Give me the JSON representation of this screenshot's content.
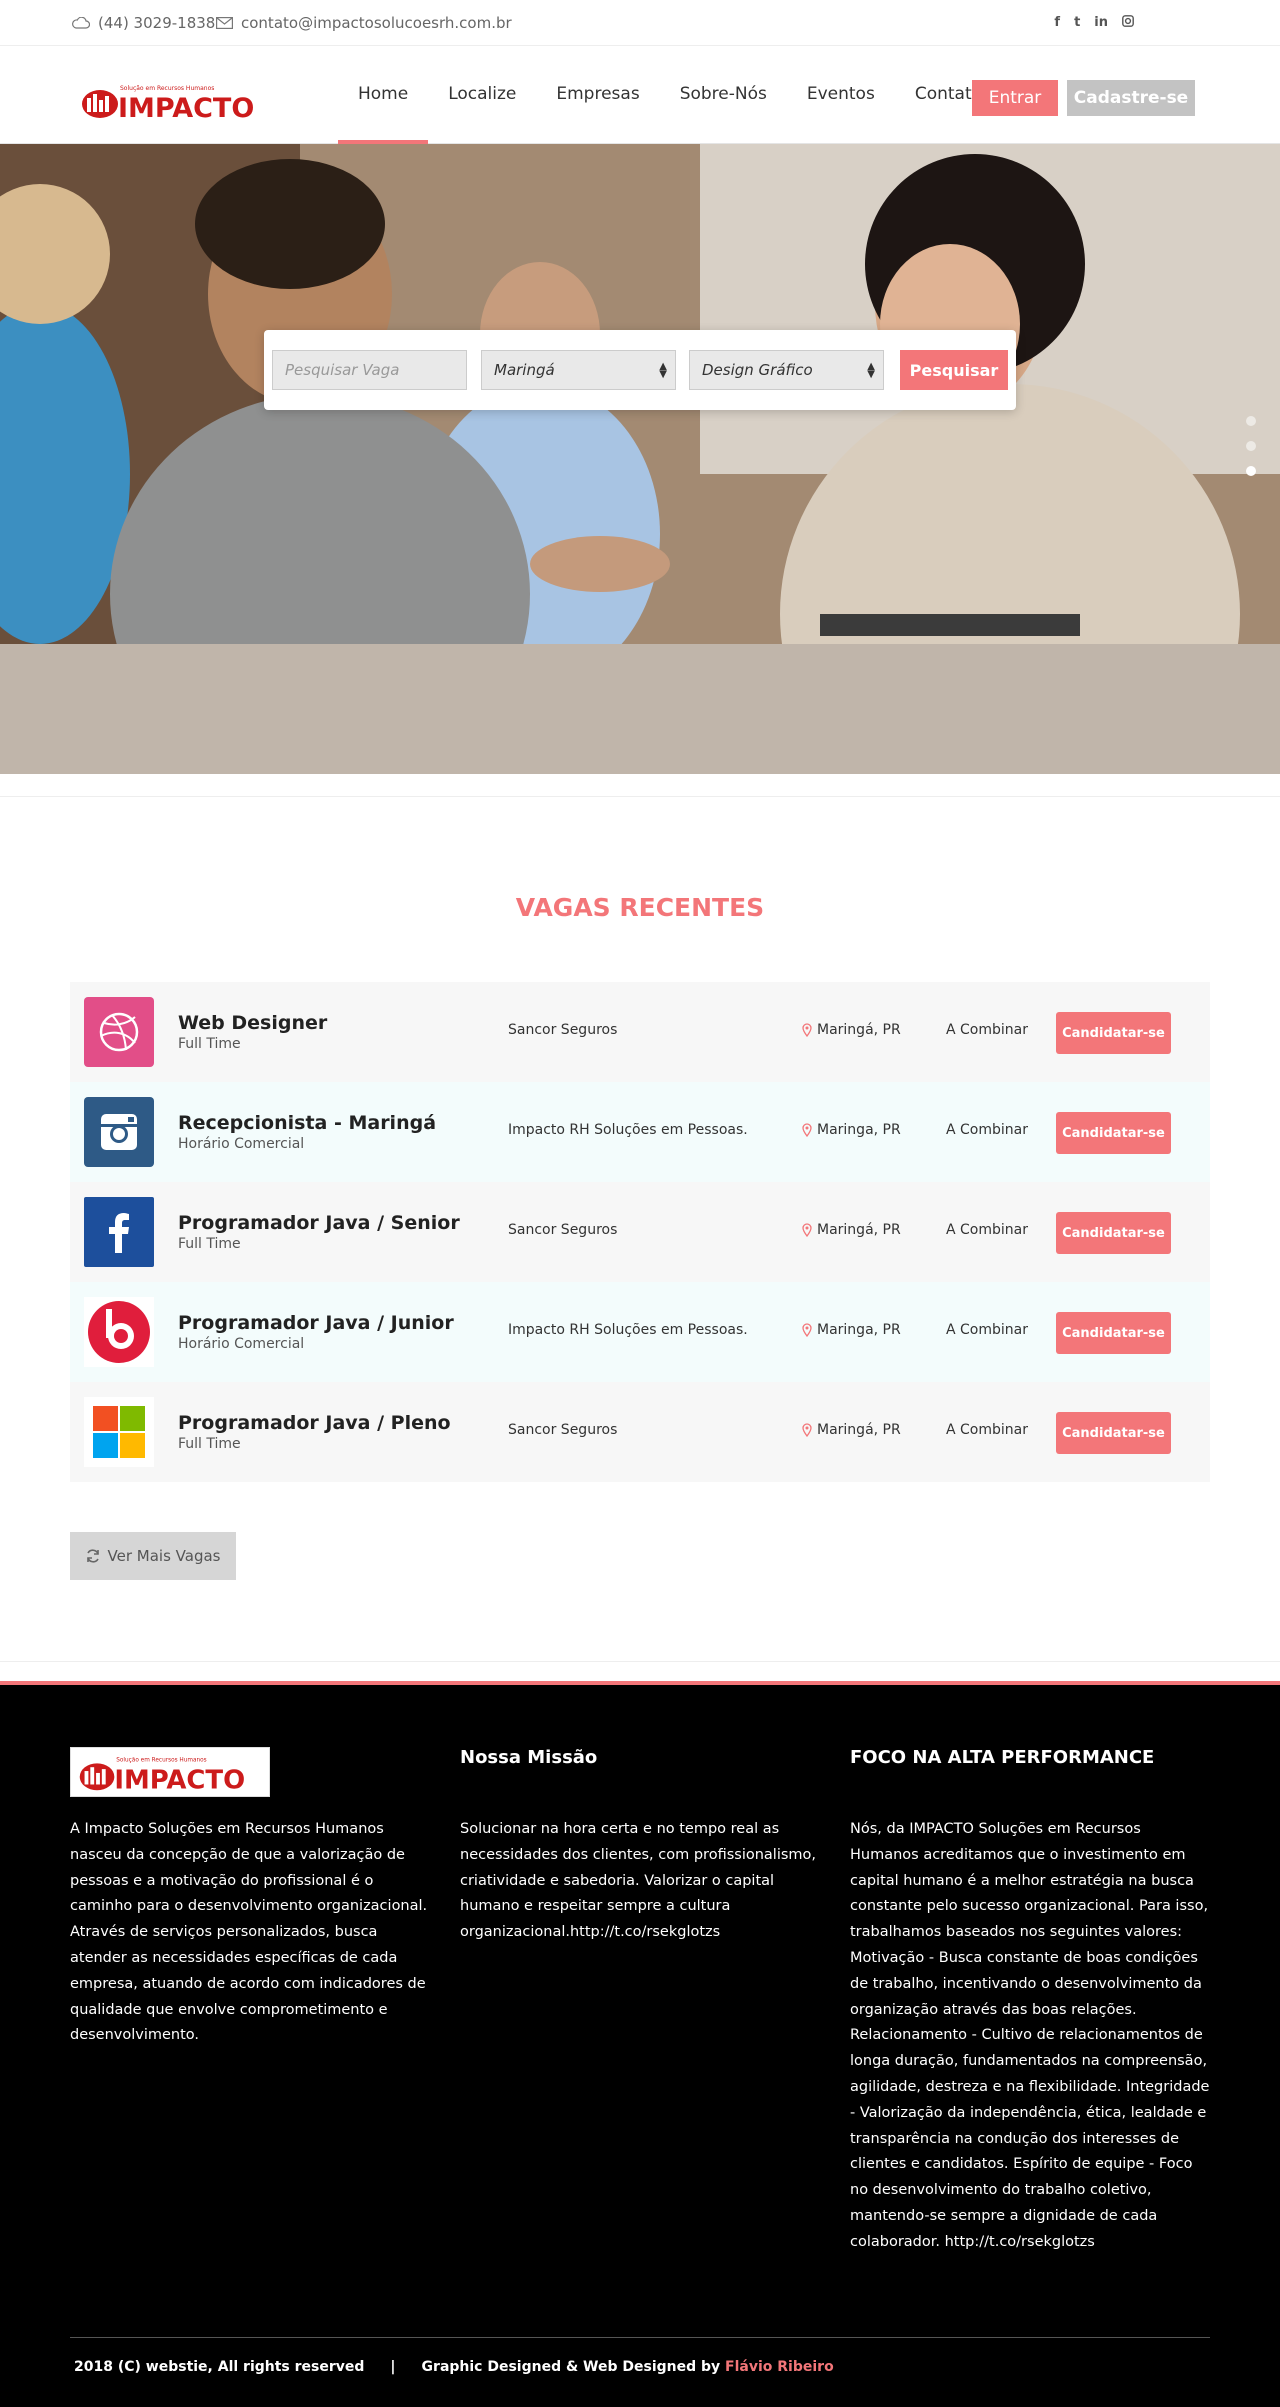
{
  "topbar": {
    "phone": "(44) 3029-1838",
    "email": "contato@impactosolucoesrh.com.br",
    "social": [
      "f",
      "t",
      "in",
      "ig"
    ]
  },
  "brand": {
    "name": "IMPACTO",
    "tagline": "Solução em Recursos Humanos",
    "accent": "#f37679",
    "logo_red": "#cc1b1b"
  },
  "nav": {
    "items": [
      "Home",
      "Localize",
      "Empresas",
      "Sobre-Nós",
      "Eventos",
      "Contato"
    ],
    "active": "Home",
    "login": "Entrar",
    "signup": "Cadastre-se"
  },
  "search": {
    "placeholder": "Pesquisar Vaga",
    "city": "Maringá",
    "category": "Design Gráfico",
    "button": "Pesquisar"
  },
  "recent": {
    "title": "VAGAS RECENTES",
    "jobs": [
      {
        "title": "Web Designer",
        "type": "Full Time",
        "company": "Sancor Seguros",
        "location": "Maringá, PR",
        "salary": "A Combinar",
        "action": "Candidatar-se",
        "icon": "dribbble-icon"
      },
      {
        "title": "Recepcionista - Maringá",
        "type": "Horário Comercial",
        "company": "Impacto RH Soluções em Pessoas.",
        "location": "Maringa, PR",
        "salary": "A Combinar",
        "action": "Candidatar-se",
        "icon": "instagram-icon"
      },
      {
        "title": "Programador Java / Senior",
        "type": "Full Time",
        "company": "Sancor Seguros",
        "location": "Maringá, PR",
        "salary": "A Combinar",
        "action": "Candidatar-se",
        "icon": "facebook-icon"
      },
      {
        "title": "Programador Java / Junior",
        "type": "Horário Comercial",
        "company": "Impacto RH Soluções em Pessoas.",
        "location": "Maringa, PR",
        "salary": "A Combinar",
        "action": "Candidatar-se",
        "icon": "beats-icon"
      },
      {
        "title": "Programador Java / Pleno",
        "type": "Full Time",
        "company": "Sancor Seguros",
        "location": "Maringá, PR",
        "salary": "A Combinar",
        "action": "Candidatar-se",
        "icon": "microsoft-icon"
      }
    ],
    "more": "Ver Mais Vagas"
  },
  "footer": {
    "about": "A Impacto Soluções em Recursos Humanos nasceu da concepção de que a valorização de pessoas e a motivação do profissional é o caminho para o desenvolvimento organizacional. Através de serviços personalizados, busca atender as necessidades específicas de cada empresa, atuando de acordo com indicadores de qualidade que envolve comprometimento e desenvolvimento.",
    "mission_title": "Nossa Missão",
    "mission": "Solucionar na hora certa e no tempo real as necessidades dos clientes, com profissionalismo, criatividade e sabedoria. Valorizar o capital humano e respeitar sempre a cultura organizacional.http://t.co/rsekglotzs",
    "focus_title": "FOCO NA ALTA PERFORMANCE",
    "focus": "Nós, da IMPACTO Soluções em Recursos Humanos acreditamos que o investimento em capital humano é a melhor estratégia na busca constante pelo sucesso organizacional. Para isso, trabalhamos baseados nos seguintes valores: Motivação - Busca constante de boas condições de trabalho, incentivando o desenvolvimento da organização através das boas relações. Relacionamento - Cultivo de relacionamentos de longa duração, fundamentados na compreensão, agilidade, destreza e na flexibilidade. Integridade - Valorização da independência, ética, lealdade e transparência na condução dos interesses de clientes e candidatos. Espírito de equipe - Foco no desenvolvimento do trabalho coletivo, mantendo-se sempre a dignidade de cada colaborador. http://t.co/rsekglotzs",
    "copyright": "2018 (C) webstie, All rights reserved",
    "divider": "|",
    "credit": "Graphic Designed & Web Designed by",
    "author": "Flávio Ribeiro"
  }
}
